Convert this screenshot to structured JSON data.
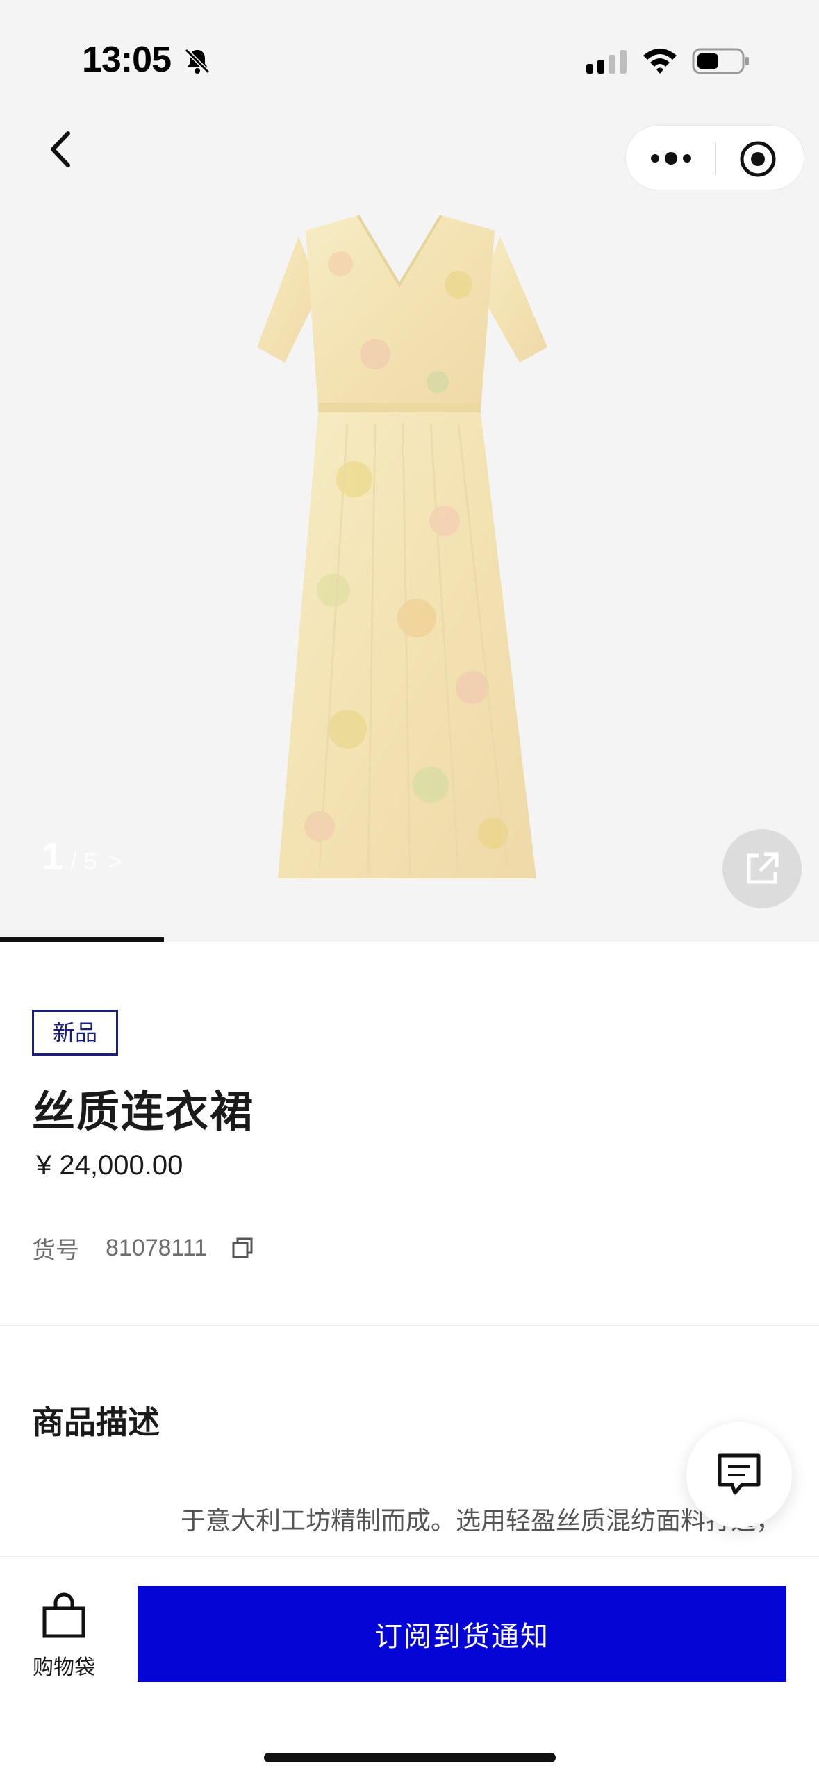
{
  "status_bar": {
    "time": "13:05"
  },
  "gallery": {
    "current_index": "1",
    "separator": "/",
    "total": "5",
    "next_arrow": ">",
    "progress_fraction": 0.2
  },
  "product": {
    "badge": "新品",
    "title": "丝质连衣裙",
    "price": "¥ 24,000.00",
    "sku_label": "货号",
    "sku_value": "81078111"
  },
  "description": {
    "heading": "商品描述",
    "text": "于意大利工坊精制而成。选用轻盈丝质混纺面料打造，缀以褶饰边缘，采用罩缩钉织和拉链 V 领设计，呈现修身版型，首"
  },
  "bottom_bar": {
    "bag_label": "购物袋",
    "notify_label": "订阅到货通知"
  },
  "colors": {
    "accent": "#0505d6",
    "badge_border": "#1a1f7a",
    "hero_bg": "#f4f4f4"
  },
  "icons": [
    "bell-off-icon",
    "signal-icon",
    "wifi-icon",
    "battery-icon",
    "back-chevron-icon",
    "more-icon",
    "close-miniprogram-icon",
    "share-icon",
    "copy-icon",
    "chat-icon",
    "shopping-bag-icon"
  ]
}
